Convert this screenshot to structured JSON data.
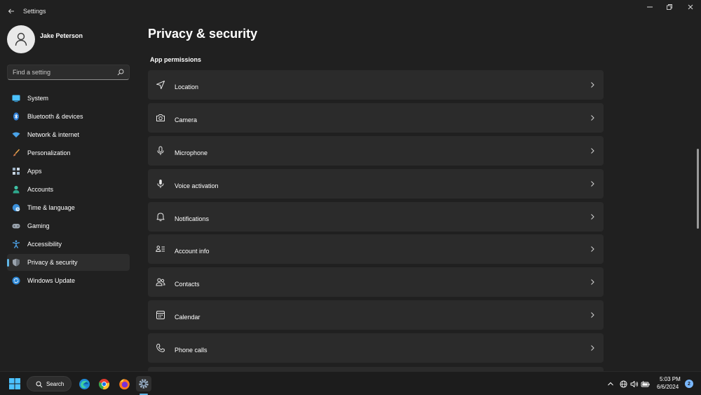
{
  "app": {
    "title": "Settings"
  },
  "user": {
    "name": "Jake Peterson"
  },
  "search": {
    "placeholder": "Find a setting"
  },
  "sidebar": {
    "items": [
      {
        "label": "System",
        "icon": "monitor-icon",
        "active": false
      },
      {
        "label": "Bluetooth & devices",
        "icon": "bluetooth-icon",
        "active": false
      },
      {
        "label": "Network & internet",
        "icon": "wifi-icon",
        "active": false
      },
      {
        "label": "Personalization",
        "icon": "brush-icon",
        "active": false
      },
      {
        "label": "Apps",
        "icon": "apps-icon",
        "active": false
      },
      {
        "label": "Accounts",
        "icon": "accounts-icon",
        "active": false
      },
      {
        "label": "Time & language",
        "icon": "globe-clock-icon",
        "active": false
      },
      {
        "label": "Gaming",
        "icon": "gamepad-icon",
        "active": false
      },
      {
        "label": "Accessibility",
        "icon": "accessibility-icon",
        "active": false
      },
      {
        "label": "Privacy & security",
        "icon": "shield-icon",
        "active": true
      },
      {
        "label": "Windows Update",
        "icon": "windows-update-icon",
        "active": false
      }
    ]
  },
  "main": {
    "title": "Privacy & security",
    "section": "App permissions",
    "items": [
      {
        "label": "Location",
        "icon": "location-icon"
      },
      {
        "label": "Camera",
        "icon": "camera-icon"
      },
      {
        "label": "Microphone",
        "icon": "microphone-icon"
      },
      {
        "label": "Voice activation",
        "icon": "voice-activation-icon"
      },
      {
        "label": "Notifications",
        "icon": "bell-icon"
      },
      {
        "label": "Account info",
        "icon": "account-info-icon"
      },
      {
        "label": "Contacts",
        "icon": "contacts-icon"
      },
      {
        "label": "Calendar",
        "icon": "calendar-icon"
      },
      {
        "label": "Phone calls",
        "icon": "phone-icon"
      }
    ]
  },
  "taskbar": {
    "search_label": "Search",
    "apps": [
      "edge-icon",
      "chrome-icon",
      "firefox-icon",
      "settings-app-icon"
    ],
    "time": "5:03 PM",
    "date": "6/6/2024",
    "notification_count": "2"
  },
  "colors": {
    "accent": "#60b6e6",
    "window_bg": "#202020",
    "card_bg": "#2b2b2b"
  }
}
